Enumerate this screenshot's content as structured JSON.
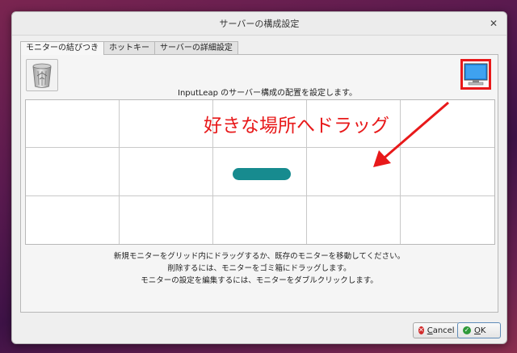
{
  "window": {
    "title": "サーバーの構成設定",
    "close_glyph": "✕"
  },
  "tabs": [
    {
      "label": "モニターの結びつき",
      "active": true
    },
    {
      "label": "ホットキー",
      "active": false
    },
    {
      "label": "サーバーの詳細設定",
      "active": false
    }
  ],
  "panel": {
    "header_text": "InputLeap のサーバー構成の配置を設定します。",
    "trash_icon": "trash-can-icon",
    "new_monitor_icon": "monitor-icon",
    "grid": {
      "rows": 3,
      "cols": 5
    },
    "annotation": "好きな場所へドラッグ",
    "instructions": [
      "新規モニターをグリッド内にドラッグするか、既存のモニターを移動してください。",
      "削除するには、モニターをゴミ箱にドラッグします。",
      "モニターの設定を編集するには、モニターをダブルクリックします。"
    ]
  },
  "buttons": {
    "cancel_label": "Cancel",
    "cancel_mnemonic": "C",
    "cancel_rest": "ancel",
    "ok_label": "OK",
    "ok_mnemonic": "O",
    "ok_rest": "K"
  },
  "colors": {
    "accent_red": "#e8191a",
    "screen_teal": "#178b8f",
    "monitor_blue": "#1e88e5"
  }
}
